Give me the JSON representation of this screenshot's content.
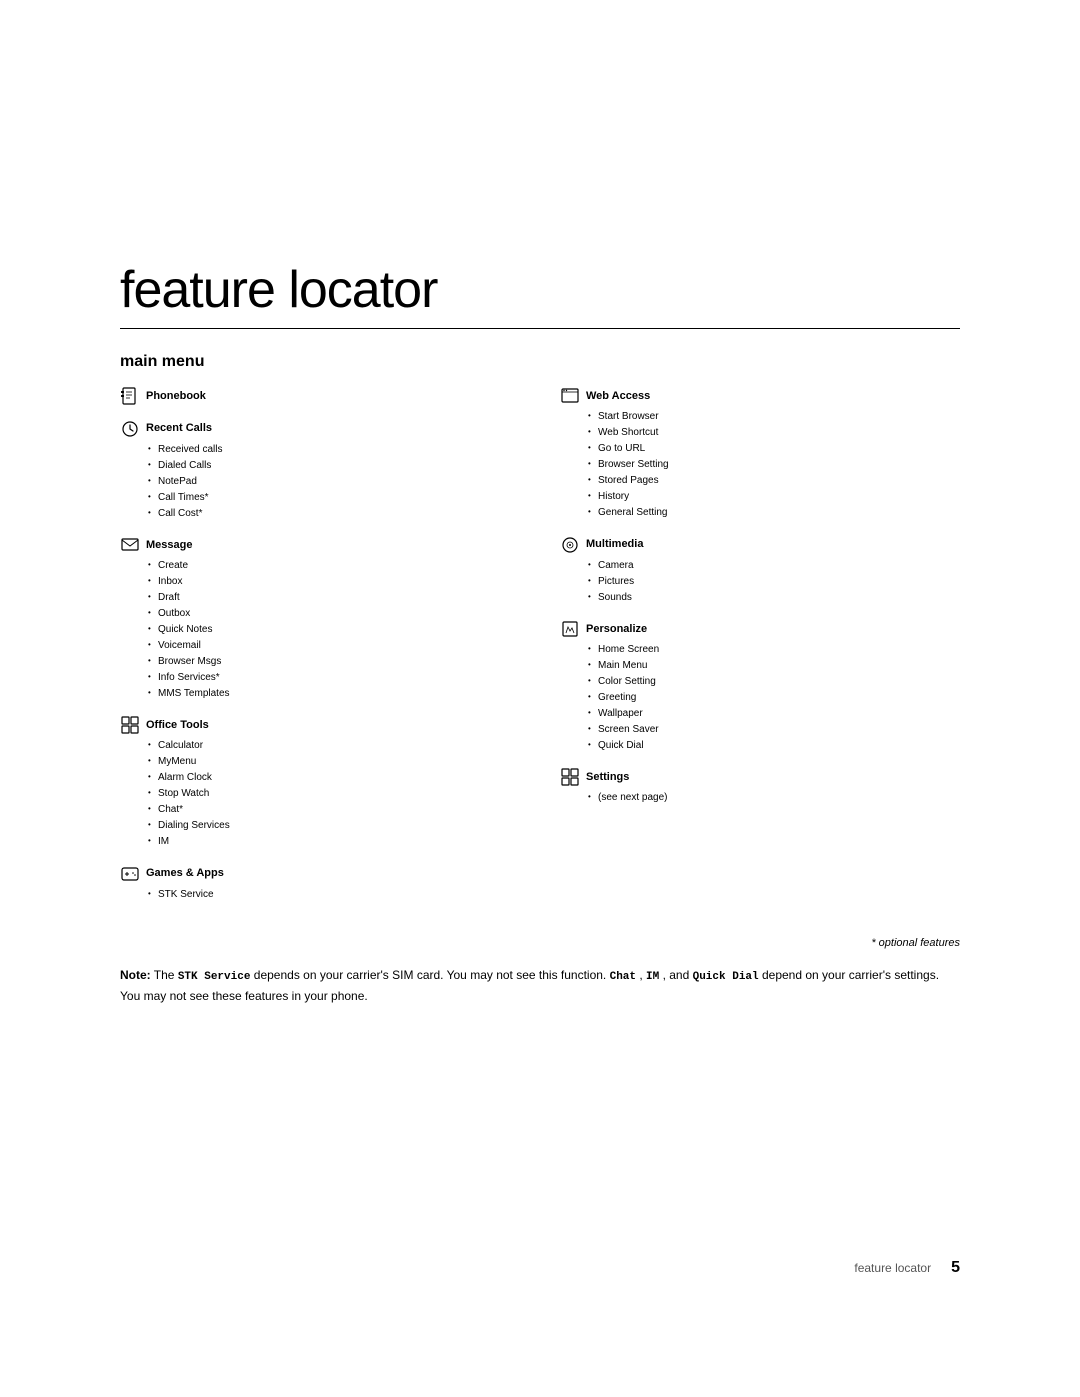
{
  "page": {
    "title": "feature locator",
    "main_menu_heading": "main menu",
    "optional_features_label": "* optional features",
    "footer_text": "feature locator",
    "footer_page": "5"
  },
  "left_column": [
    {
      "id": "phonebook",
      "title": "Phonebook",
      "items": []
    },
    {
      "id": "recent-calls",
      "title": "Recent Calls",
      "items": [
        "Received calls",
        "Dialed Calls",
        "NotePad",
        "Call Times*",
        "Call Cost*"
      ]
    },
    {
      "id": "message",
      "title": "Message",
      "items": [
        "Create",
        "Inbox",
        "Draft",
        "Outbox",
        "Quick Notes",
        "Voicemail",
        "Browser Msgs",
        "Info Services*",
        "MMS Templates"
      ]
    },
    {
      "id": "office-tools",
      "title": "Office Tools",
      "items": [
        "Calculator",
        "MyMenu",
        "Alarm Clock",
        "Stop Watch",
        "Chat*",
        "Dialing Services",
        "IM"
      ]
    },
    {
      "id": "games-apps",
      "title": "Games & Apps",
      "items": [
        "STK Service"
      ]
    }
  ],
  "right_column": [
    {
      "id": "web-access",
      "title": "Web Access",
      "items": [
        "Start Browser",
        "Web Shortcut",
        "Go to URL",
        "Browser Setting",
        "Stored Pages",
        "History",
        "General Setting"
      ]
    },
    {
      "id": "multimedia",
      "title": "Multimedia",
      "items": [
        "Camera",
        "Pictures",
        "Sounds"
      ]
    },
    {
      "id": "personalize",
      "title": "Personalize",
      "items": [
        "Home Screen",
        "Main Menu",
        "Color Setting",
        "Greeting",
        "Wallpaper",
        "Screen Saver",
        "Quick Dial"
      ]
    },
    {
      "id": "settings",
      "title": "Settings",
      "items": [
        "(see next page)"
      ]
    }
  ],
  "note": {
    "prefix": "Note:",
    "text1": " The ",
    "stk_service": "STK Service",
    "text2": " depends on your carrier's SIM card. You may not see this function. ",
    "chat": "Chat",
    "text3": ", ",
    "im": "IM",
    "text4": ", and ",
    "quick_dial": "Quick Dial",
    "text5": " depend on your carrier's settings. You may not see these features in your phone."
  }
}
